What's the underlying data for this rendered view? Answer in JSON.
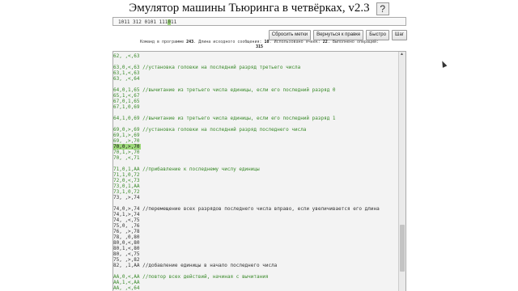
{
  "title": "Эмулятор машины Тьюринга в четвёрках, v2.3",
  "help_label": "?",
  "tape": {
    "before": "1011 312 0101 111",
    "current": "0",
    "after": "11"
  },
  "buttons": {
    "reset_marks": "Сбросить метки",
    "return_right": "Вернуться к правке",
    "fast": "Быстро",
    "step": "Шаг"
  },
  "status": {
    "label_commands": "Команд в программе",
    "commands": "243",
    "label_length": "Длина исходного сообщения:",
    "length": "10",
    "label_cells": "Использовано ячеек:",
    "cells": "22",
    "label_ops": "Выполнено операций:",
    "ops": "315"
  },
  "code_lines": [
    {
      "t": "62, ,<,63",
      "k": "g"
    },
    {
      "t": "",
      "k": ""
    },
    {
      "t": "63,0,<,63 //установка головки на последний разряд третьего числа",
      "k": "g"
    },
    {
      "t": "63,1,<,63",
      "k": "g"
    },
    {
      "t": "63, ,<,64",
      "k": "g"
    },
    {
      "t": "",
      "k": ""
    },
    {
      "t": "64,0,1,65 //вычитание из третьего числа единицы, если его последний разряд 0",
      "k": "g"
    },
    {
      "t": "65,1,<,67",
      "k": "g"
    },
    {
      "t": "67,0,1,65",
      "k": "g"
    },
    {
      "t": "67,1,0,69",
      "k": "g"
    },
    {
      "t": "",
      "k": ""
    },
    {
      "t": "64,1,0,69 //вычитание из третьего числа единицы, если его последний разряд 1",
      "k": "g"
    },
    {
      "t": "",
      "k": ""
    },
    {
      "t": "69,0,>,69 //установка головки на последний разряд последнего числа",
      "k": "g"
    },
    {
      "t": "69,1,>,69",
      "k": "g"
    },
    {
      "t": "69, ,>,70",
      "k": "g"
    },
    {
      "t": "70,0,>,70",
      "k": "cur"
    },
    {
      "t": "70,1,>,70",
      "k": "g"
    },
    {
      "t": "70, ,<,71",
      "k": "g"
    },
    {
      "t": "",
      "k": ""
    },
    {
      "t": "71,0,1,AA //прибавление к последнему числу единицы",
      "k": "g"
    },
    {
      "t": "71,1,0,72",
      "k": "g"
    },
    {
      "t": "72,0,<,73",
      "k": "g"
    },
    {
      "t": "73,0,1,AA",
      "k": "g"
    },
    {
      "t": "73,1,0,72",
      "k": "g"
    },
    {
      "t": "73, ,>,74",
      "k": ""
    },
    {
      "t": "",
      "k": ""
    },
    {
      "t": "74,0,>,74 //перемещение всех разрядов последнего числа вправо, если увеличивается его длина",
      "k": ""
    },
    {
      "t": "74,1,>,74",
      "k": ""
    },
    {
      "t": "74, ,<,75",
      "k": ""
    },
    {
      "t": "75,0, ,76",
      "k": ""
    },
    {
      "t": "76, ,>,78",
      "k": ""
    },
    {
      "t": "78, ,0,80",
      "k": ""
    },
    {
      "t": "80,0,<,80",
      "k": ""
    },
    {
      "t": "80,1,<,80",
      "k": ""
    },
    {
      "t": "80, ,<,75",
      "k": ""
    },
    {
      "t": "75, ,>,82",
      "k": ""
    },
    {
      "t": "82, ,1,AA //добавление единицы в начало последнего числа",
      "k": ""
    },
    {
      "t": "",
      "k": ""
    },
    {
      "t": "AA,0,<,AA //повтор всех действий, начиная с вычитания",
      "k": "g"
    },
    {
      "t": "AA,1,<,AA",
      "k": "g"
    },
    {
      "t": "AA, ,<,64",
      "k": "g"
    }
  ]
}
